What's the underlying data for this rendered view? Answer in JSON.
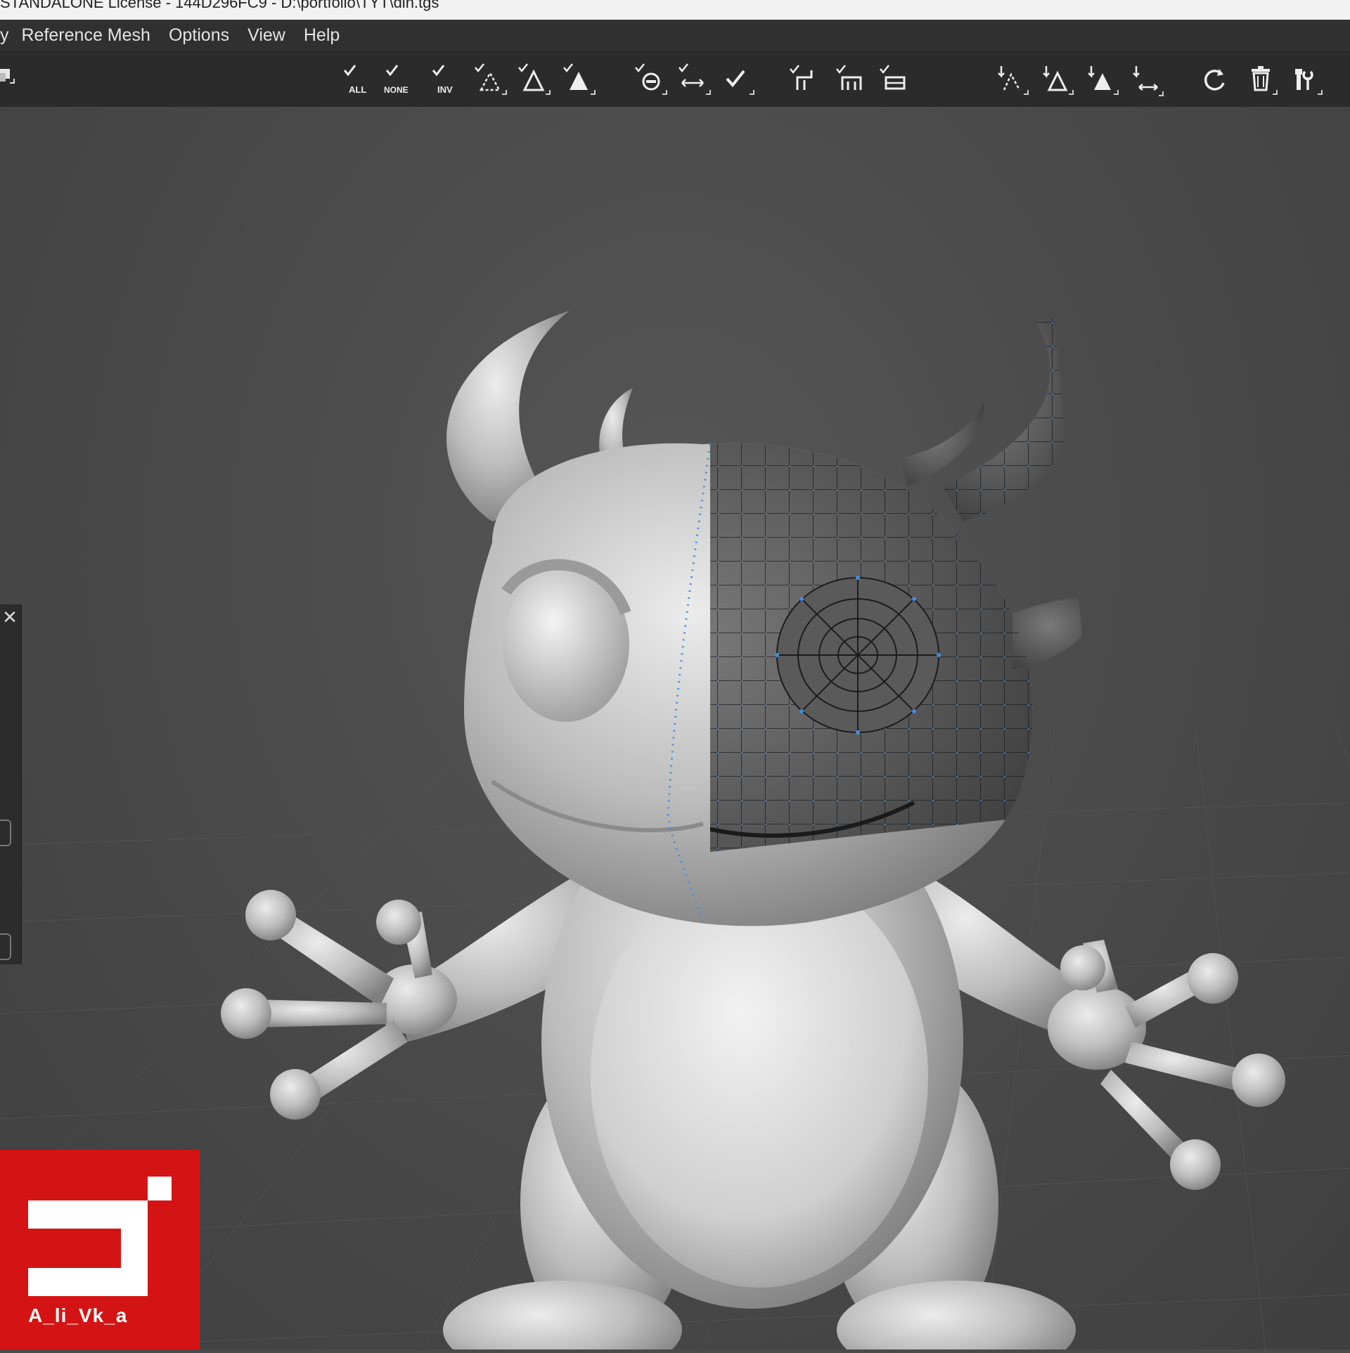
{
  "window": {
    "title": "STANDALONE License - 144D296FC9 - D:\\portfolio\\TYT\\din.tgs"
  },
  "menubar": {
    "items": [
      {
        "label": "y"
      },
      {
        "label": "Reference Mesh"
      },
      {
        "label": "Options"
      },
      {
        "label": "View"
      },
      {
        "label": "Help"
      }
    ]
  },
  "toolbar": {
    "tools": [
      {
        "icon": "select-all-icon",
        "caption": "ALL"
      },
      {
        "icon": "select-none-icon",
        "caption": "NONE"
      },
      {
        "icon": "select-invert-icon",
        "caption": "INV"
      },
      {
        "icon": "select-vertices-icon",
        "caption": ""
      },
      {
        "icon": "select-edges-icon",
        "caption": ""
      },
      {
        "icon": "select-faces-icon",
        "caption": ""
      },
      {
        "icon": "select-loop-icon",
        "caption": ""
      },
      {
        "icon": "select-ring-icon",
        "caption": ""
      },
      {
        "icon": "confirm-selection-icon",
        "caption": ""
      },
      {
        "icon": "extrude-icon",
        "caption": ""
      },
      {
        "icon": "bridge-icon",
        "caption": ""
      },
      {
        "icon": "fill-icon",
        "caption": ""
      },
      {
        "icon": "add-vertex-icon",
        "caption": ""
      },
      {
        "icon": "add-edge-icon",
        "caption": ""
      },
      {
        "icon": "add-face-icon",
        "caption": ""
      },
      {
        "icon": "slide-edge-icon",
        "caption": ""
      },
      {
        "icon": "refresh-icon",
        "caption": ""
      },
      {
        "icon": "delete-icon",
        "caption": ""
      },
      {
        "icon": "tools-icon",
        "caption": ""
      }
    ]
  },
  "viewport": {
    "background": "#4b4b4b",
    "mesh_wire_color": "#3d8fe0"
  },
  "watermark": {
    "text": "A_li_Vk_a",
    "color": "#d41414"
  }
}
